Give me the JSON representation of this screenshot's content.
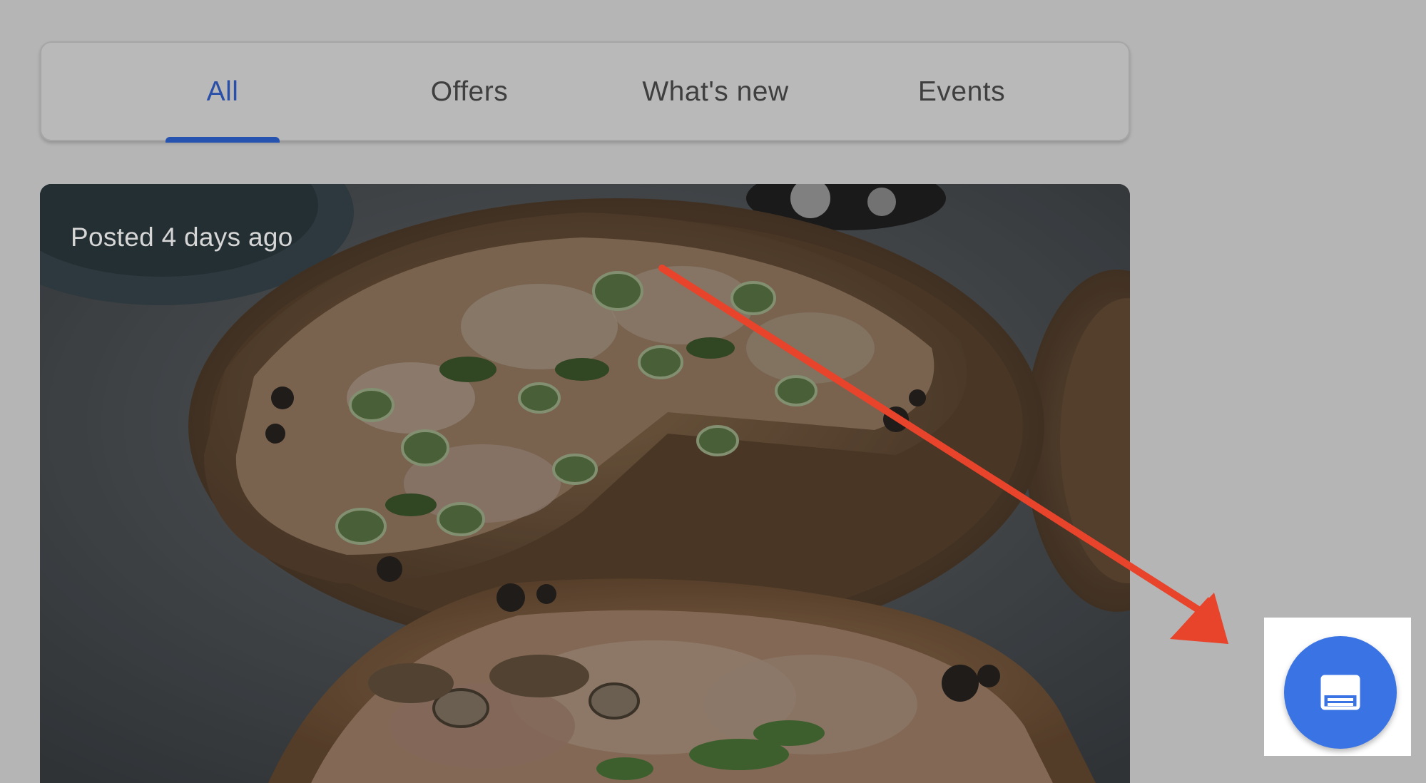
{
  "tabs": {
    "items": [
      {
        "label": "All",
        "active": true
      },
      {
        "label": "Offers",
        "active": false
      },
      {
        "label": "What's new",
        "active": false
      },
      {
        "label": "Events",
        "active": false
      }
    ]
  },
  "post": {
    "posted_label": "Posted 4 days ago",
    "image_subject": "pizza-photo"
  },
  "fab": {
    "icon": "post-icon",
    "highlighted": true
  },
  "annotation": {
    "arrow_color": "#e8432b",
    "arrow_icon": "pointer-arrow"
  },
  "colors": {
    "accent": "#2653b0",
    "fab": "#3a73e3",
    "overlay_bg": "#b5b5b5"
  }
}
